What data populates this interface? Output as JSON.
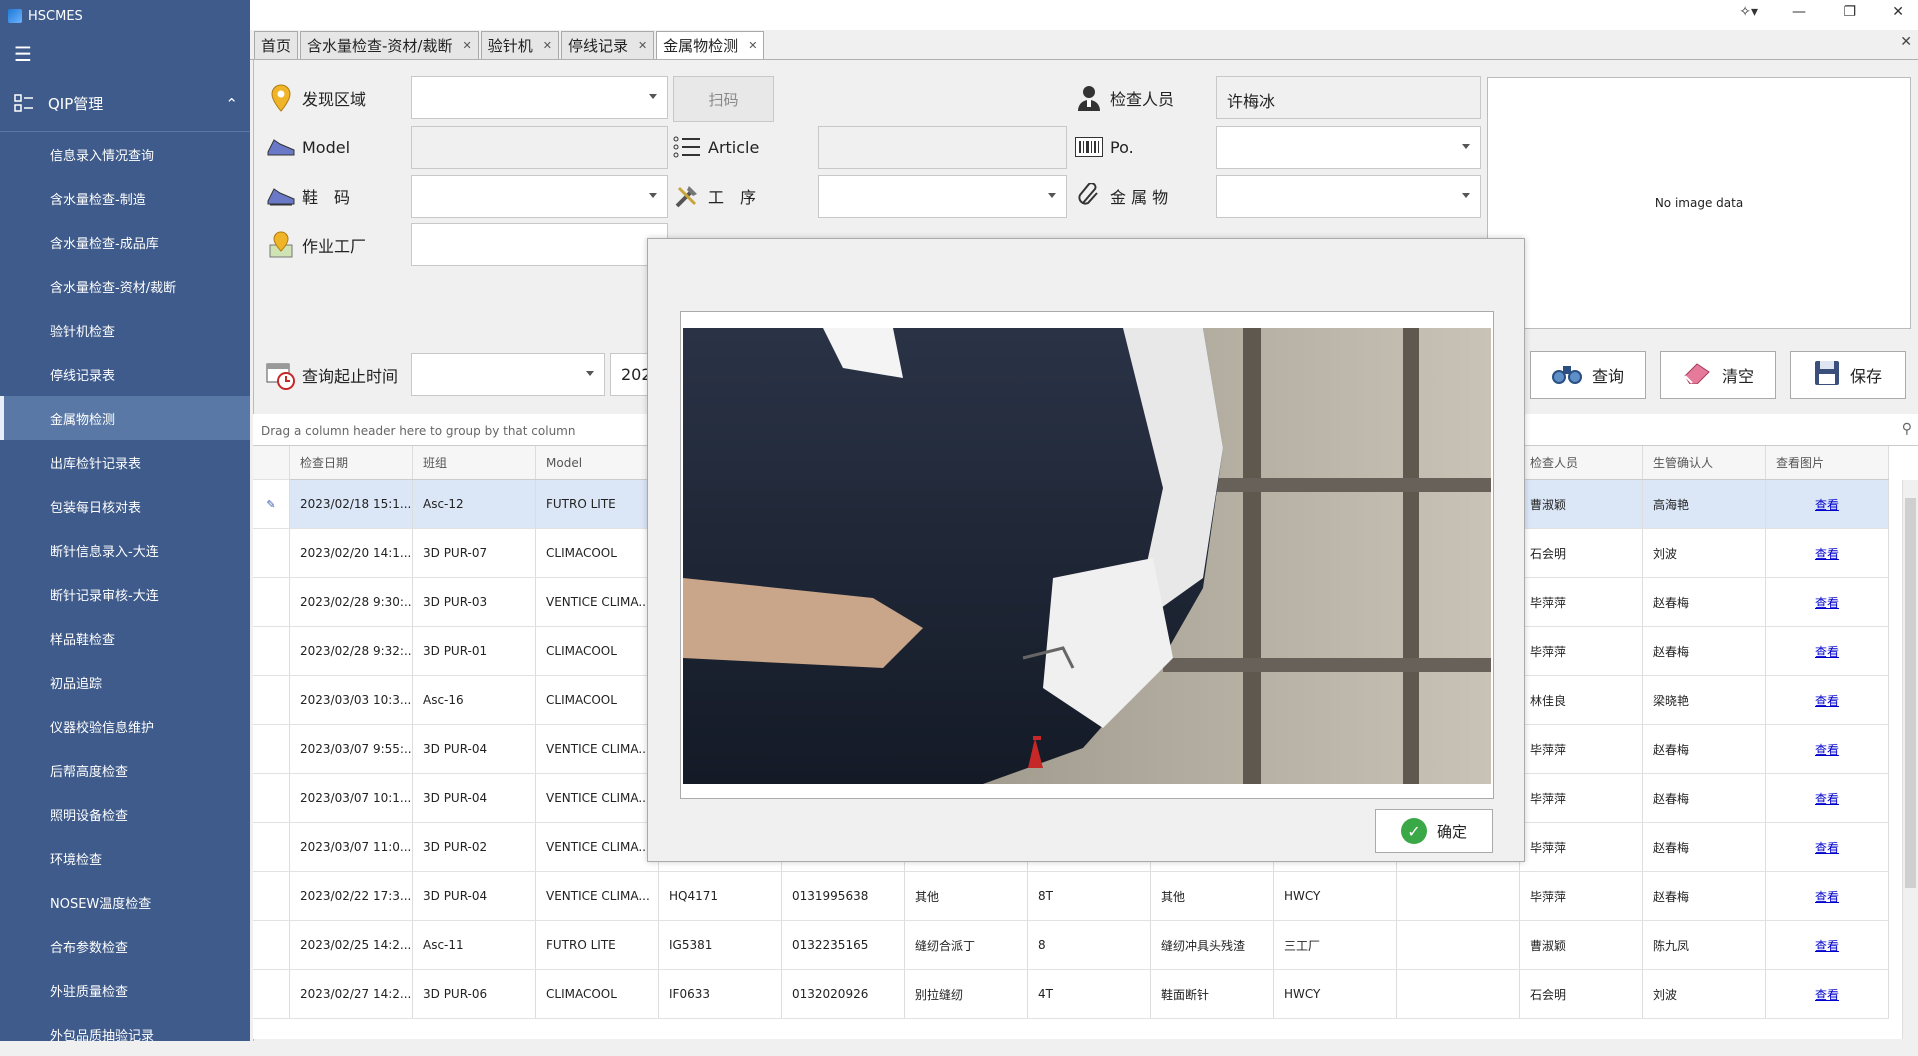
{
  "app": {
    "title": "HSCMES"
  },
  "sidebar": {
    "section": "QIP管理",
    "items": [
      {
        "label": "信息录入情况查询"
      },
      {
        "label": "含水量检查-制造"
      },
      {
        "label": "含水量检查-成品库"
      },
      {
        "label": "含水量检查-资材/裁断"
      },
      {
        "label": "验针机检查"
      },
      {
        "label": "停线记录表"
      },
      {
        "label": "金属物检测"
      },
      {
        "label": "出库检针记录表"
      },
      {
        "label": "包装每日核对表"
      },
      {
        "label": "断针信息录入-大连"
      },
      {
        "label": "断针记录审核-大连"
      },
      {
        "label": "样品鞋检查"
      },
      {
        "label": "初品追踪"
      },
      {
        "label": "仪器校验信息维护"
      },
      {
        "label": "后帮高度检查"
      },
      {
        "label": "照明设备检查"
      },
      {
        "label": "环境检查"
      },
      {
        "label": "NOSEW温度检查"
      },
      {
        "label": "合布参数检查"
      },
      {
        "label": "外驻质量检查"
      },
      {
        "label": "外包品质抽验记录"
      }
    ]
  },
  "tabs": [
    {
      "label": "首页"
    },
    {
      "label": "含水量检查-资材/裁断"
    },
    {
      "label": "验针机"
    },
    {
      "label": "停线记录"
    },
    {
      "label": "金属物检测"
    }
  ],
  "form": {
    "area_label": "发现区域",
    "scan_label": "扫码",
    "inspector_label": "检查人员",
    "inspector_value": "许梅冰",
    "model_label": "Model",
    "article_label": "Article",
    "po_label": "Po.",
    "size_label": "鞋　码",
    "process_label": "工　序",
    "metal_label": "金 属 物",
    "factory_label": "作业工厂",
    "date_label": "查询起止时间",
    "date_partial": "202",
    "no_image": "No image data"
  },
  "actions": {
    "query": "查询",
    "clear": "清空",
    "save": "保存"
  },
  "grid": {
    "group_hint": "Drag a column header here to group by that column",
    "headers_left": [
      "检查日期",
      "班组",
      "Model"
    ],
    "headers_right": [
      "检查人员",
      "生管确认人",
      "查看图片"
    ],
    "view_label": "查看",
    "rows": [
      {
        "date": "2023/02/18 15:1...",
        "team": "Asc-12",
        "model": "FUTRO LITE",
        "inspector": "曹淑颖",
        "confirm": "高海艳"
      },
      {
        "date": "2023/02/20 14:1...",
        "team": "3D PUR-07",
        "model": "CLIMACOOL",
        "inspector": "石会明",
        "confirm": "刘波"
      },
      {
        "date": "2023/02/28 9:30:...",
        "team": "3D PUR-03",
        "model": "VENTICE CLIMA...",
        "inspector": "毕萍萍",
        "confirm": "赵春梅"
      },
      {
        "date": "2023/02/28 9:32:...",
        "team": "3D PUR-01",
        "model": "CLIMACOOL",
        "inspector": "毕萍萍",
        "confirm": "赵春梅"
      },
      {
        "date": "2023/03/03 10:3...",
        "team": "Asc-16",
        "model": "CLIMACOOL",
        "inspector": "林佳良",
        "confirm": "梁晓艳"
      },
      {
        "date": "2023/03/07 9:55:...",
        "team": "3D PUR-04",
        "model": "VENTICE CLIMA...",
        "inspector": "毕萍萍",
        "confirm": "赵春梅"
      },
      {
        "date": "2023/03/07 10:1...",
        "team": "3D PUR-04",
        "model": "VENTICE CLIMA...",
        "inspector": "毕萍萍",
        "confirm": "赵春梅"
      },
      {
        "date": "2023/03/07 11:0...",
        "team": "3D PUR-02",
        "model": "VENTICE CLIMA...",
        "inspector": "毕萍萍",
        "confirm": "赵春梅"
      },
      {
        "date": "2023/02/22 17:3...",
        "team": "3D PUR-04",
        "model": "VENTICE CLIMA...",
        "article": "HQ4171",
        "po": "0131995638",
        "process": "其他",
        "size": "8T",
        "metal": "其他",
        "factory": "HWCY",
        "inspector": "毕萍萍",
        "confirm": "赵春梅"
      },
      {
        "date": "2023/02/25 14:2...",
        "team": "Asc-11",
        "model": "FUTRO LITE",
        "article": "IG5381",
        "po": "0132235165",
        "process": "缝纫合派丁",
        "size": "8",
        "metal": "缝纫冲具头残渣",
        "factory": "三工厂",
        "inspector": "曹淑颖",
        "confirm": "陈九凤"
      },
      {
        "date": "2023/02/27 14:2...",
        "team": "3D PUR-06",
        "model": "CLIMACOOL",
        "article": "IF0633",
        "po": "0132020926",
        "process": "别拉缝纫",
        "size": "4T",
        "metal": "鞋面断针",
        "factory": "HWCY",
        "inspector": "石会明",
        "confirm": "刘波"
      }
    ]
  },
  "modal": {
    "ok_label": "确定"
  }
}
